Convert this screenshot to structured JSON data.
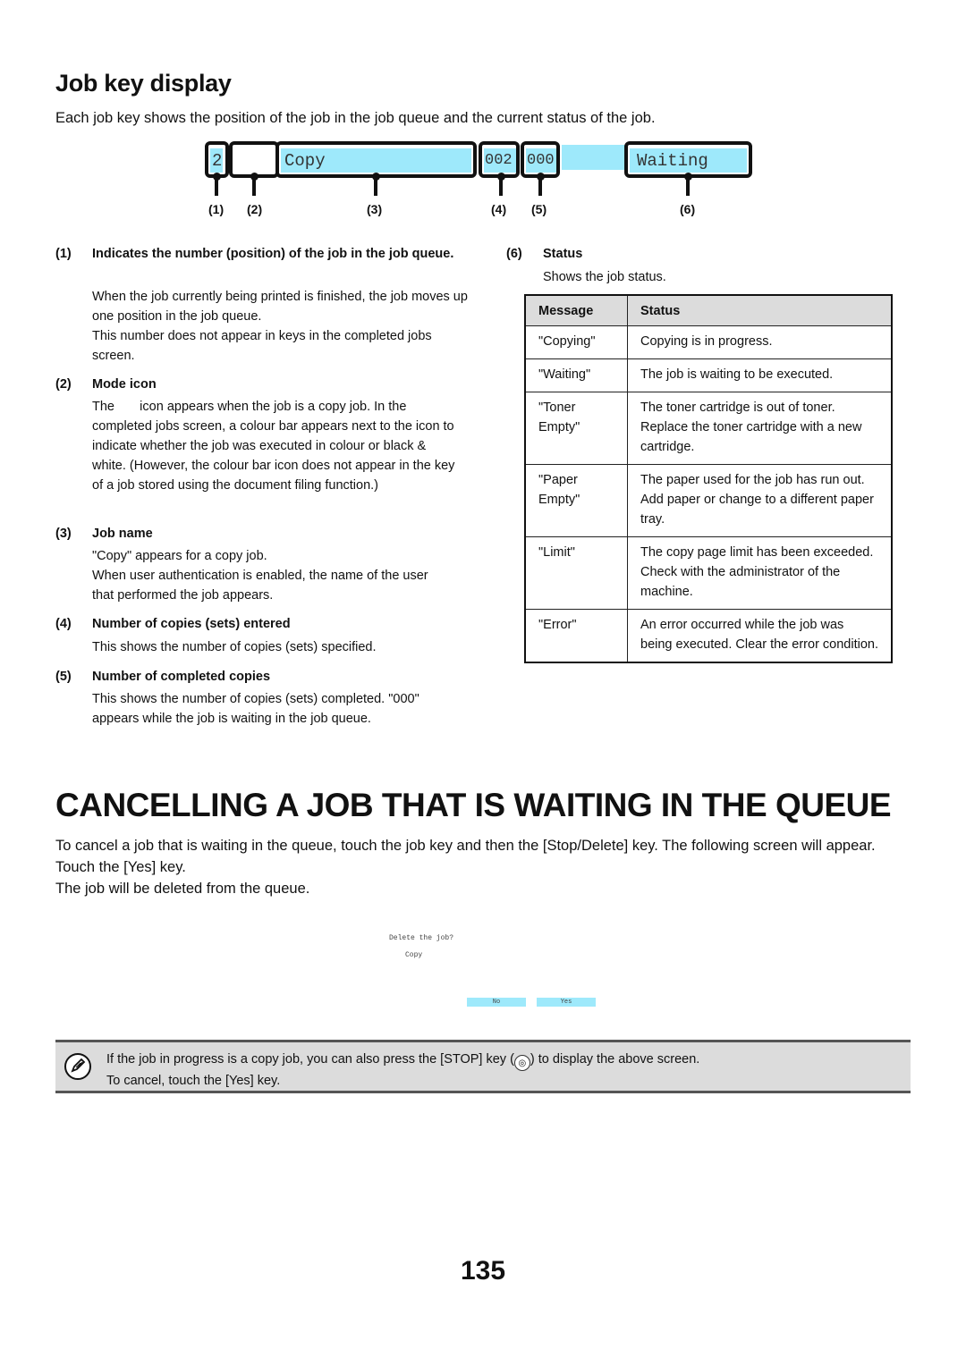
{
  "job_key_section": {
    "title": "Job key display",
    "intro": "Each job key shows the position of the job in the job queue and the current status of the job.",
    "diagram": {
      "position": "2",
      "job_name": "Copy",
      "copies_entered": "002",
      "copies_completed": "000",
      "status": "Waiting",
      "callouts": [
        "(1)",
        "(2)",
        "(3)",
        "(4)",
        "(5)",
        "(6)"
      ],
      "accent_color": "#9ee9fb"
    },
    "items": [
      {
        "num": "(1)",
        "title": "Indicates the number (position) of the job in the job queue.",
        "body": [
          "When the job currently being printed is finished, the job moves up one position in the job queue.",
          "This number does not appear in keys in the completed jobs screen."
        ]
      },
      {
        "num": "(2)",
        "title": "Mode icon",
        "body": [
          "The       icon appears when the job is a copy job. In the completed jobs screen, a colour bar appears next to the icon to indicate whether the job was executed in colour or black & white. (However, the colour bar icon does not appear in the key of a job stored using the document filing function.)"
        ]
      },
      {
        "num": "(3)",
        "title": "Job name",
        "body": [
          "\"Copy\" appears for a copy job.",
          "When user authentication is enabled, the name of the user that performed the job appears."
        ]
      },
      {
        "num": "(4)",
        "title": "Number of copies (sets) entered",
        "body": [
          "This shows the number of copies (sets) specified."
        ]
      },
      {
        "num": "(5)",
        "title": "Number of completed copies",
        "body": [
          "This shows the number of copies (sets) completed. \"000\" appears while the job is waiting in the job queue."
        ]
      },
      {
        "num": "(6)",
        "title": "Status",
        "body": [
          "Shows the job status."
        ]
      }
    ],
    "status_table": {
      "headers": [
        "Message",
        "Status"
      ],
      "rows": [
        [
          "\"Copying\"",
          "Copying is in progress."
        ],
        [
          "\"Waiting\"",
          "The job is waiting to be executed."
        ],
        [
          "\"Toner Empty\"",
          "The toner cartridge is out of toner. Replace the toner cartridge with a new cartridge."
        ],
        [
          "\"Paper Empty\"",
          "The paper used for the job has run out. Add paper or change to a different paper tray."
        ],
        [
          "\"Limit\"",
          "The copy page limit has been exceeded. Check with the administrator of the machine."
        ],
        [
          "\"Error\"",
          "An error occurred while the job was being executed. Clear the error condition."
        ]
      ]
    }
  },
  "cancel_section": {
    "title": "CANCELLING A JOB THAT IS WAITING IN THE QUEUE",
    "para1": "To cancel a job that is waiting in the queue, touch the job key and then the [Stop/Delete] key. The following screen will appear. Touch the [Yes] key.",
    "para2": "The job will be deleted from the queue.",
    "dialog": {
      "prompt": "Delete the job?",
      "job_name": "Copy",
      "no_label": "No",
      "yes_label": "Yes"
    },
    "note": {
      "line1_before": "If the job in progress is a copy job, you can also press the [STOP] key (",
      "line1_after": ") to display the above screen.",
      "line2": "To cancel, touch the [Yes] key.",
      "stop_glyph": "◎"
    }
  },
  "page_number": "135"
}
